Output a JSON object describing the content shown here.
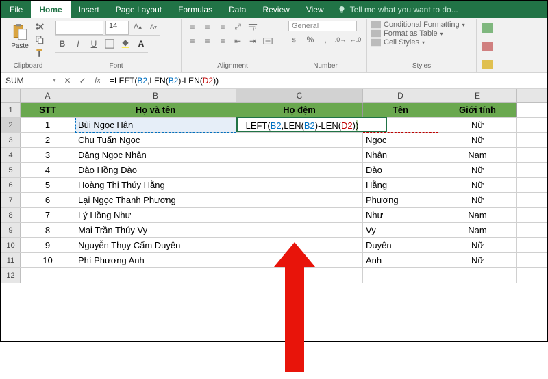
{
  "tabs": [
    "File",
    "Home",
    "Insert",
    "Page Layout",
    "Formulas",
    "Data",
    "Review",
    "View"
  ],
  "active_tab": "Home",
  "tell_me": "Tell me what you want to do...",
  "ribbon_groups": [
    "Clipboard",
    "Font",
    "Alignment",
    "Number",
    "Styles"
  ],
  "paste_label": "Paste",
  "font_size": "14",
  "number_format": "General",
  "styles": {
    "cond": "Conditional Formatting",
    "table": "Format as Table",
    "cell": "Cell Styles"
  },
  "name_box": "SUM",
  "formula_plain": "=LEFT(B2,LEN(B2)-LEN(D2))",
  "columns": [
    "A",
    "B",
    "C",
    "D",
    "E"
  ],
  "col_widths": {
    "A": 80,
    "B": 235,
    "C": 185,
    "D": 110,
    "E": 115
  },
  "headers": {
    "A": "STT",
    "B": "Họ và tên",
    "C": "Họ đệm",
    "D": "Tên",
    "E": "Giới tính"
  },
  "rows": [
    {
      "A": "1",
      "B": "Bùi Ngọc Hân",
      "C": "=LEFT(B2,LEN(B2)-LEN(D2))",
      "D": "",
      "E": "Nữ"
    },
    {
      "A": "2",
      "B": "Chu Tuấn Ngọc",
      "C": "",
      "D": "Ngọc",
      "E": "Nữ"
    },
    {
      "A": "3",
      "B": "Đặng Ngọc Nhân",
      "C": "",
      "D": "Nhân",
      "E": "Nam"
    },
    {
      "A": "4",
      "B": "Đào Hồng Đào",
      "C": "",
      "D": "Đào",
      "E": "Nữ"
    },
    {
      "A": "5",
      "B": "Hoàng Thị Thúy Hằng",
      "C": "",
      "D": "Hằng",
      "E": "Nữ"
    },
    {
      "A": "6",
      "B": "Lại Ngọc Thanh Phương",
      "C": "",
      "D": "Phương",
      "E": "Nữ"
    },
    {
      "A": "7",
      "B": "Lý Hồng Như",
      "C": "",
      "D": "Như",
      "E": "Nam"
    },
    {
      "A": "8",
      "B": "Mai Trần Thúy Vy",
      "C": "",
      "D": "Vy",
      "E": "Nam"
    },
    {
      "A": "9",
      "B": "Nguyễn Thụy Cẩm Duyên",
      "C": "",
      "D": "Duyên",
      "E": "Nữ"
    },
    {
      "A": "10",
      "B": "Phí Phương Anh",
      "C": "",
      "D": "Anh",
      "E": "Nữ"
    }
  ],
  "active_cell": "C2",
  "selected_row_header": 2,
  "selected_col_header": "C"
}
